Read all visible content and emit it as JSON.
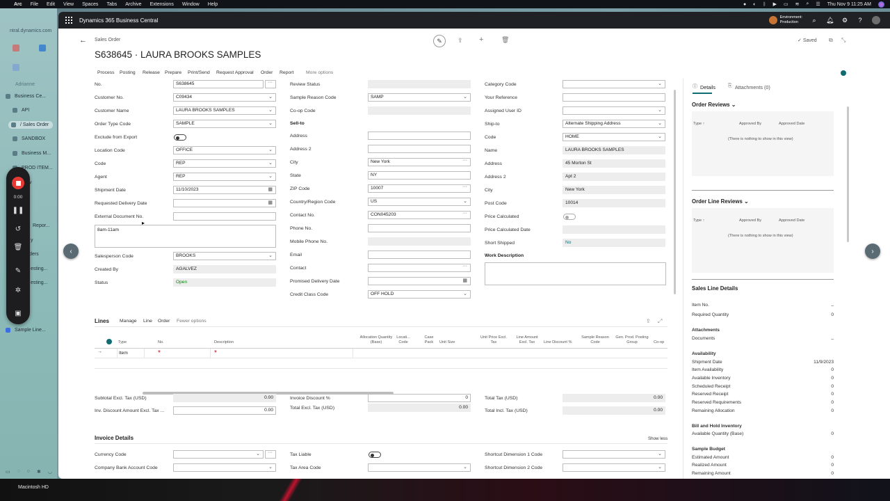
{
  "menubar": {
    "apple": "",
    "items": [
      "Arc",
      "File",
      "Edit",
      "View",
      "Spaces",
      "Tabs",
      "Archive",
      "Extensions",
      "Window",
      "Help"
    ],
    "clock": "Thu Nov 9  11:25 AM"
  },
  "sidebar": {
    "url": "ntral.dynamics.com",
    "user": "Adrianne",
    "items": [
      "Business Ce...",
      "API",
      "/ Sales Order",
      "SANDBOX",
      "Business M...",
      "PROD ITEM...",
      "v",
      "Repor...",
      "y",
      "ders",
      "esting...",
      "esting...",
      "Sample Line..."
    ]
  },
  "recorder": {
    "time": "0:00"
  },
  "app": {
    "title": "Dynamics 365 Business Central",
    "env_line1": "Environment:",
    "env_line2": "Production"
  },
  "page": {
    "breadcrumb": "Sales Order",
    "title": "S638645 · LAURA BROOKS SAMPLES",
    "saved": "Saved",
    "actions": [
      "Process",
      "Posting",
      "Release",
      "Prepare",
      "Print/Send",
      "Request Approval",
      "Order",
      "Report",
      "More options"
    ]
  },
  "general": {
    "col1": [
      {
        "label": "No.",
        "value": "S638645"
      },
      {
        "label": "Customer No.",
        "value": "C09434"
      },
      {
        "label": "Customer Name",
        "value": "LAURA BROOKS SAMPLES"
      },
      {
        "label": "Order Type Code",
        "value": "SAMPLE"
      },
      {
        "label": "Exclude from Export",
        "value": ""
      },
      {
        "label": "Location Code",
        "value": "OFFICE"
      },
      {
        "label": "Code",
        "value": "REP"
      },
      {
        "label": "Agent",
        "value": "REP"
      },
      {
        "label": "Shipment Date",
        "value": "11/10/2023"
      },
      {
        "label": "Requested Delivery Date",
        "value": ""
      },
      {
        "label": "External Document No.",
        "value": ""
      }
    ],
    "note": "8am-11am",
    "col1b": [
      {
        "label": "Salesperson Code",
        "value": "BROOKS"
      },
      {
        "label": "Created By",
        "value": "AGALVEZ"
      },
      {
        "label": "Status",
        "value": "Open"
      }
    ],
    "col2": [
      {
        "label": "Review Status",
        "value": ""
      },
      {
        "label": "Sample Reason Code",
        "value": "SAMP"
      },
      {
        "label": "Co-op Code",
        "value": ""
      },
      {
        "label": "Sell-to",
        "value": ""
      },
      {
        "label": "Address",
        "value": ""
      },
      {
        "label": "Address 2",
        "value": ""
      },
      {
        "label": "City",
        "value": "New York"
      },
      {
        "label": "State",
        "value": "NY"
      },
      {
        "label": "ZIP Code",
        "value": "10007"
      },
      {
        "label": "Country/Region Code",
        "value": "US"
      },
      {
        "label": "Contact No.",
        "value": "CON045203"
      },
      {
        "label": "Phone No.",
        "value": ""
      },
      {
        "label": "Mobile Phone No.",
        "value": ""
      },
      {
        "label": "Email",
        "value": ""
      },
      {
        "label": "Contact",
        "value": ""
      },
      {
        "label": "Promised Delivery Date",
        "value": ""
      },
      {
        "label": "Credit Class Code",
        "value": "OFF HOLD"
      }
    ],
    "col3": [
      {
        "label": "Category Code",
        "value": ""
      },
      {
        "label": "Your Reference",
        "value": ""
      },
      {
        "label": "Assigned User ID",
        "value": ""
      },
      {
        "label": "Ship-to",
        "value": "Alternate Shipping Address"
      },
      {
        "label": "Code",
        "value": "HOME"
      },
      {
        "label": "Name",
        "value": "LAURA BROOKS SAMPLES"
      },
      {
        "label": "Address",
        "value": "45 Morton St"
      },
      {
        "label": "Address 2",
        "value": "Apt 2"
      },
      {
        "label": "City",
        "value": "New York"
      },
      {
        "label": "Post Code",
        "value": "10014"
      },
      {
        "label": "Price Calculated",
        "value": ""
      },
      {
        "label": "Price Calculated Date",
        "value": ""
      },
      {
        "label": "Short Shipped",
        "value": "No"
      }
    ],
    "work_description": "Work Description"
  },
  "lines": {
    "title": "Lines",
    "actions": [
      "Manage",
      "Line",
      "Order",
      "Fewer options"
    ],
    "columns": [
      "Type",
      "No.",
      "Description",
      "Allocation Quantity (Base)",
      "Locati... Code",
      "Case Pack",
      "Unit Size",
      "Unit Price Excl. Tax",
      "Line Amount Excl. Tax",
      "Line Discount %",
      "Sample Reason Code",
      "Gen. Prod. Posting Group",
      "Co-op"
    ],
    "row": {
      "type": "Item",
      "no": "*",
      "description": "*"
    }
  },
  "totals": {
    "subtotal_label": "Subtotal Excl. Tax (USD)",
    "subtotal": "0.00",
    "invdisc_amt_label": "Inv. Discount Amount Excl. Tax ...",
    "invdisc_amt": "0.00",
    "invdisc_pct_label": "Invoice Discount %",
    "invdisc_pct": "0",
    "total_excl_label": "Total Excl. Tax (USD)",
    "total_excl": "0.00",
    "total_tax_label": "Total Tax (USD)",
    "total_tax": "0.00",
    "total_incl_label": "Total Incl. Tax (USD)",
    "total_incl": "0.00"
  },
  "invoice": {
    "title": "Invoice Details",
    "show_less": "Show less",
    "currency_label": "Currency Code",
    "bank_label": "Company Bank Account Code",
    "tax_liable_label": "Tax Liable",
    "tax_area_label": "Tax Area Code",
    "dim1_label": "Shortcut Dimension 1 Code",
    "dim2_label": "Shortcut Dimension 2 Code"
  },
  "factbox": {
    "tab_details": "Details",
    "tab_attachments": "Attachments (0)",
    "order_reviews": "Order Reviews",
    "order_line_reviews": "Order Line Reviews",
    "col_type": "Type ↑",
    "col_approved_by": "Approved By",
    "col_approved_date": "Approved Date",
    "empty": "(There is nothing to show in this view)",
    "sales_line_details": "Sales Line Details",
    "item_no": "Item No.",
    "item_no_val": "_",
    "req_qty": "Required Quantity",
    "req_qty_val": "0",
    "attachments": "Attachments",
    "documents": "Documents",
    "documents_val": "_",
    "availability": "Availability",
    "avail_rows": [
      {
        "label": "Shipment Date",
        "value": "11/9/2023"
      },
      {
        "label": "Item Availability",
        "value": "0"
      },
      {
        "label": "Available Inventory",
        "value": "0"
      },
      {
        "label": "Scheduled Receipt",
        "value": "0"
      },
      {
        "label": "Reserved Receipt",
        "value": "0"
      },
      {
        "label": "Reserved Requirements",
        "value": "0"
      },
      {
        "label": "Remaining Allocation",
        "value": "0"
      }
    ],
    "bill_hold": "Bill and Hold Inventory",
    "avail_qty_base": "Available Quantity (Base)",
    "avail_qty_base_val": "0",
    "sample_budget": "Sample Budget",
    "budget_rows": [
      {
        "label": "Estimated Amount",
        "value": "0"
      },
      {
        "label": "Realized Amount",
        "value": "0"
      },
      {
        "label": "Remaining Amount",
        "value": "0"
      }
    ]
  },
  "dock": {
    "disk": "Macintosh HD"
  },
  "colors": {
    "accent": "#0f6c73",
    "status_open": "#107c10",
    "topbar": "#1f2124"
  }
}
